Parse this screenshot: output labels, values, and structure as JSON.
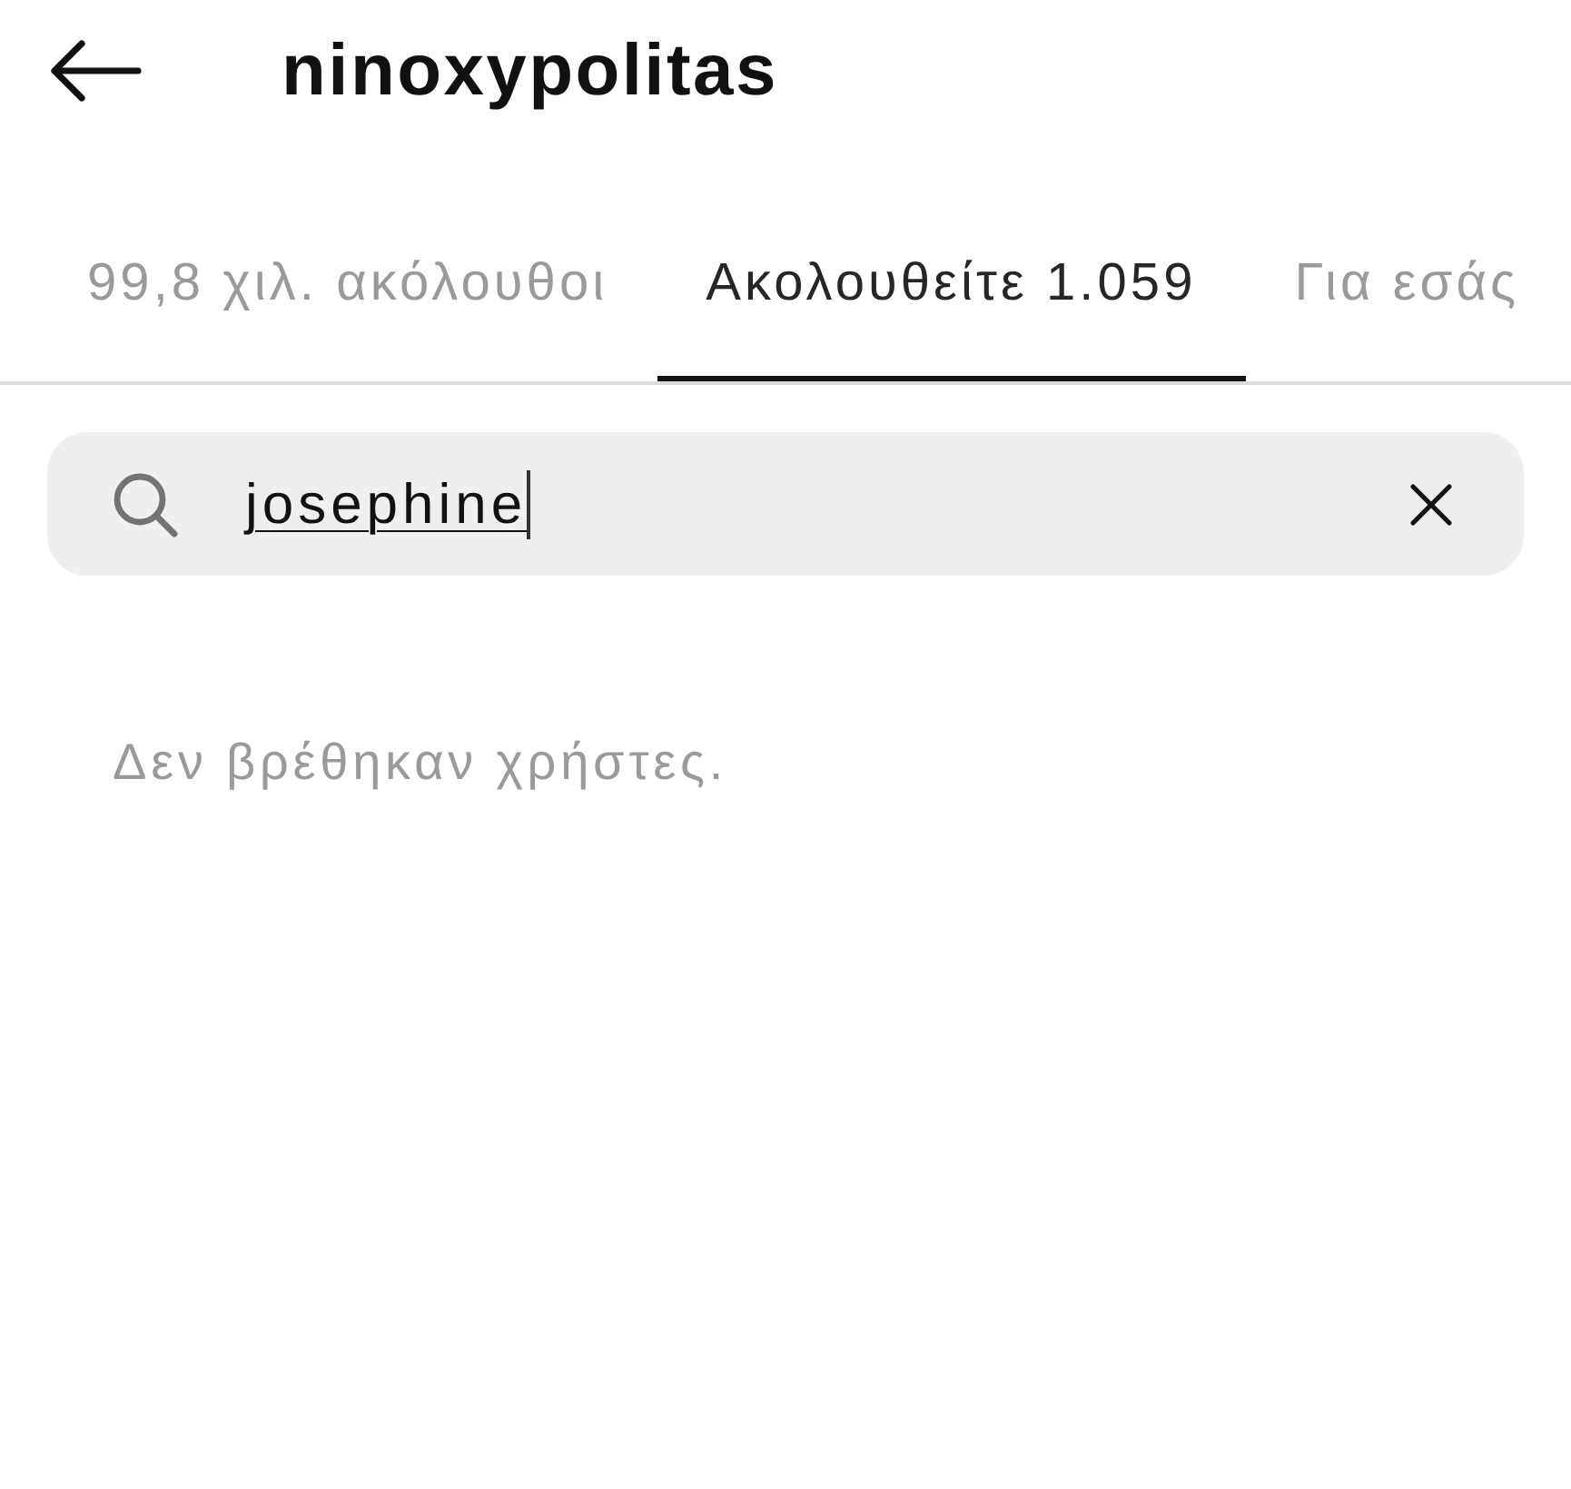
{
  "header": {
    "title": "ninoxypolitas"
  },
  "tabs": [
    {
      "label": "99,8 χιλ. ακόλουθοι",
      "selected": false
    },
    {
      "label": "Ακολουθείτε 1.059",
      "selected": true
    },
    {
      "label": "Για εσάς",
      "selected": false
    }
  ],
  "search": {
    "value": "josephine"
  },
  "empty_message": "Δεν βρέθηκαν χρήστες."
}
